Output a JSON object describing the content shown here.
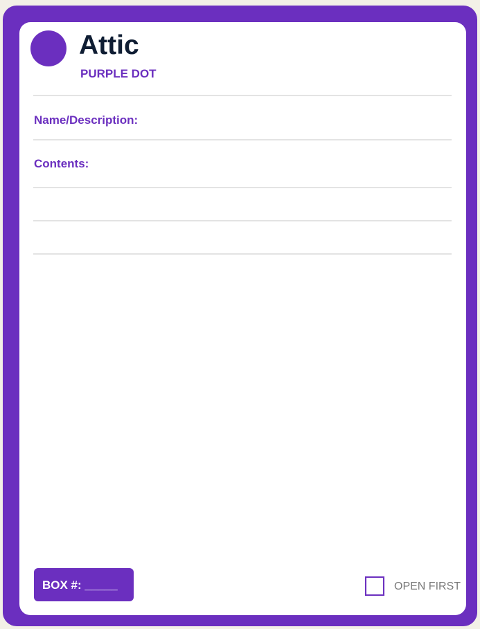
{
  "label": {
    "room": "Attic",
    "color_code": "PURPLE DOT",
    "fields": {
      "name_description": "Name/Description:",
      "contents": "Contents:"
    },
    "box_number": "BOX #: _____",
    "open_first": "OPEN FIRST"
  },
  "colors": {
    "accent": "#6b2fbf",
    "title": "#0f1d33",
    "background": "#f3f0e7",
    "rule": "#e3e3e3"
  },
  "icons": {
    "color_dot": "purple-dot-icon",
    "checkbox": "checkbox-icon"
  }
}
